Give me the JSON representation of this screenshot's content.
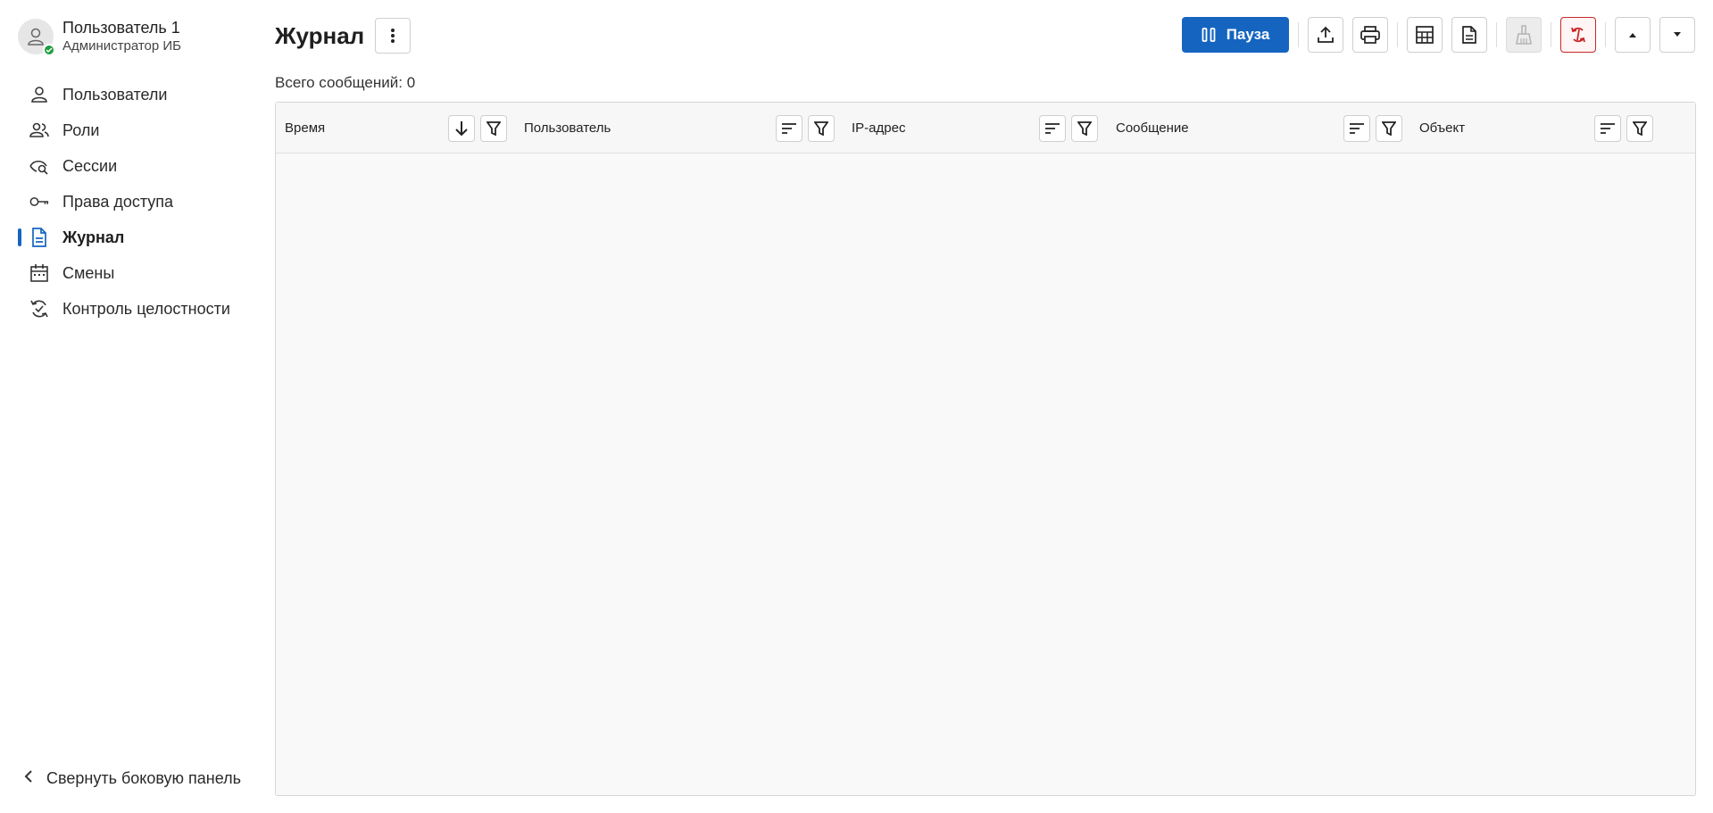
{
  "user": {
    "name": "Пользователь 1",
    "role": "Администратор ИБ"
  },
  "sidebar": {
    "items": [
      {
        "label": "Пользователи",
        "icon": "person-icon"
      },
      {
        "label": "Роли",
        "icon": "people-icon"
      },
      {
        "label": "Сессии",
        "icon": "eye-search-icon"
      },
      {
        "label": "Права доступа",
        "icon": "key-icon"
      },
      {
        "label": "Журнал",
        "icon": "document-icon",
        "active": true
      },
      {
        "label": "Смены",
        "icon": "calendar-icon"
      },
      {
        "label": "Контроль целостности",
        "icon": "sync-check-icon"
      }
    ],
    "collapse_label": "Свернуть боковую панель"
  },
  "header": {
    "title": "Журнал",
    "pause_label": "Пауза",
    "message_count_label": "Всего сообщений: 0"
  },
  "table": {
    "columns": [
      {
        "label": "Время",
        "sort": "descending"
      },
      {
        "label": "Пользователь",
        "sort": "none"
      },
      {
        "label": "IP-адрес",
        "sort": "none"
      },
      {
        "label": "Сообщение",
        "sort": "none"
      },
      {
        "label": "Объект",
        "sort": "none"
      }
    ],
    "rows": []
  },
  "colors": {
    "accent": "#1565c0",
    "status_online": "#1e9e3e",
    "danger": "#c62828"
  }
}
